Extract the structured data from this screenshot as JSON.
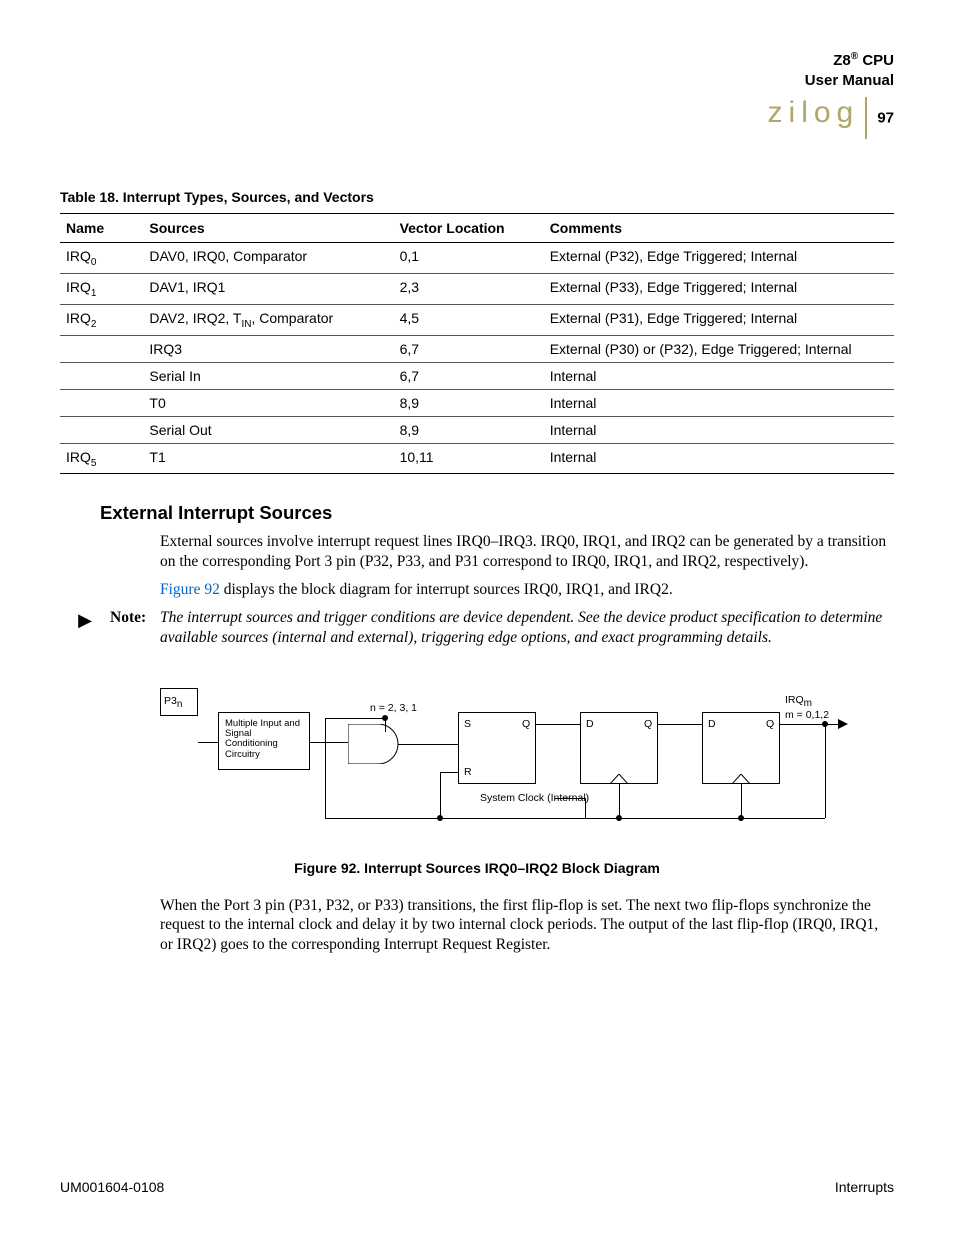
{
  "header": {
    "title_line1": "Z8",
    "title_reg": "®",
    "title_line1b": " CPU",
    "title_line2": "User Manual",
    "logo_text": "zilog",
    "page_number": "97"
  },
  "table": {
    "caption": "Table 18. Interrupt Types, Sources, and Vectors",
    "columns": [
      "Name",
      "Sources",
      "Vector Location",
      "Comments"
    ],
    "rows": [
      {
        "name": "IRQ",
        "name_sub": "0",
        "sources": "DAV0, IRQ0, Comparator",
        "sources_sub": "",
        "vector": "0,1",
        "comments": "External (P32), Edge Triggered; Internal",
        "border": true
      },
      {
        "name": "IRQ",
        "name_sub": "1",
        "sources": "DAV1, IRQ1",
        "sources_sub": "",
        "vector": "2,3",
        "comments": "External (P33), Edge Triggered; Internal",
        "border": true
      },
      {
        "name": "IRQ",
        "name_sub": "2",
        "sources_pre": "DAV2, IRQ2, T",
        "sources_sub": "IN",
        "sources_post": ", Comparator",
        "vector": "4,5",
        "comments": "External (P31), Edge Triggered; Internal",
        "border": true
      },
      {
        "name": "",
        "name_sub": "",
        "sources": "IRQ3",
        "sources_sub": "",
        "vector": "6,7",
        "comments": "External (P30) or (P32), Edge Triggered; Internal",
        "border": true
      },
      {
        "name": "",
        "name_sub": "",
        "sources": "Serial In",
        "sources_sub": "",
        "vector": "6,7",
        "comments": "Internal",
        "border": true
      },
      {
        "name": "",
        "name_sub": "",
        "sources": "T0",
        "sources_sub": "",
        "vector": "8,9",
        "comments": "Internal",
        "border": true
      },
      {
        "name": "",
        "name_sub": "",
        "sources": "Serial Out",
        "sources_sub": "",
        "vector": "8,9",
        "comments": "Internal",
        "border": true
      },
      {
        "name": "IRQ",
        "name_sub": "5",
        "sources": "T1",
        "sources_sub": "",
        "vector": "10,11",
        "comments": "Internal",
        "border": true,
        "last": true
      }
    ]
  },
  "section": {
    "heading": "External Interrupt Sources",
    "para1": "External sources involve interrupt request lines IRQ0–IRQ3. IRQ0, IRQ1, and IRQ2 can be generated by a transition on the corresponding Port 3 pin (P32, P33, and P31 correspond to IRQ0, IRQ1, and IRQ2, respectively).",
    "para2_pre": "",
    "para2_link": "Figure 92",
    "para2_post": " displays the block diagram for interrupt sources IRQ0, IRQ1, and IRQ2.",
    "note_label": "Note:",
    "note_body": "The interrupt sources and trigger conditions are device dependent. See the device product specification to determine available sources (internal and external), triggering edge options, and exact programming details."
  },
  "figure": {
    "p3_label": "P3",
    "p3_sub": "n",
    "block_text": "Multiple Input and Signal Conditioning Circuitry",
    "n_label": "n = 2, 3, 1",
    "S": "S",
    "Q": "Q",
    "R": "R",
    "D": "D",
    "clock_label": "System Clock (Internal)",
    "irq_label": "IRQ",
    "irq_sub": "m",
    "m_label": "m = 0,1,2",
    "caption": "Figure 92. Interrupt Sources IRQ0–IRQ2 Block Diagram"
  },
  "after_figure": "When the Port 3 pin (P31, P32, or P33) transitions, the first flip-flop is set. The next two flip-flops synchronize the request to the internal clock and delay it by two internal clock periods. The output of the last flip-flop (IRQ0, IRQ1, or IRQ2) goes to the corresponding Interrupt Request Register.",
  "footer": {
    "left": "UM001604-0108",
    "right": "Interrupts"
  }
}
